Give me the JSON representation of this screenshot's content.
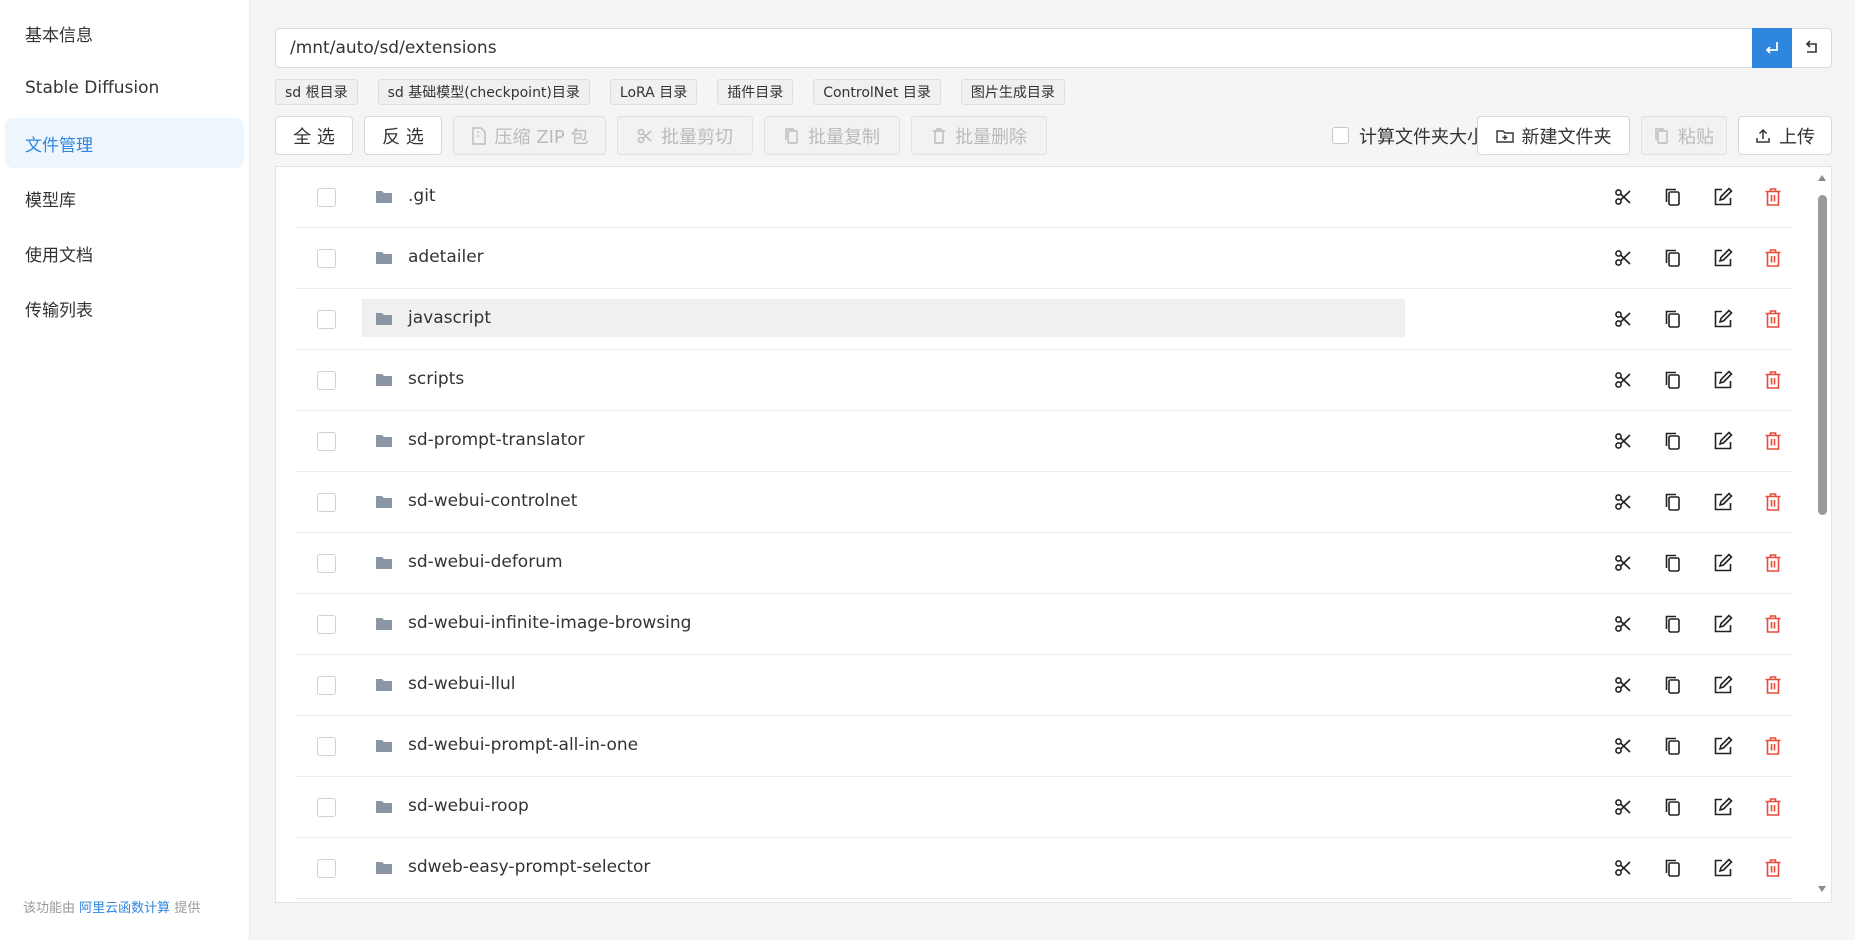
{
  "colors": {
    "accent": "#2e86de",
    "danger": "#e74c3c",
    "folder": "#8a96a3"
  },
  "sidebar": {
    "items": [
      {
        "label": "基本信息",
        "active": false
      },
      {
        "label": "Stable Diffusion",
        "active": false
      },
      {
        "label": "文件管理",
        "active": true
      },
      {
        "label": "模型库",
        "active": false
      },
      {
        "label": "使用文档",
        "active": false
      },
      {
        "label": "传输列表",
        "active": false
      }
    ],
    "footer": {
      "prefix": "该功能由",
      "link": "阿里云函数计算",
      "suffix": "提供"
    }
  },
  "path_bar": {
    "value": "/mnt/auto/sd/extensions",
    "go_icon": "enter-icon",
    "back_icon": "return-icon"
  },
  "shortcuts": [
    "sd 根目录",
    "sd 基础模型(checkpoint)目录",
    "LoRA 目录",
    "插件目录",
    "ControlNet 目录",
    "图片生成目录"
  ],
  "toolbar": {
    "select_all": "全 选",
    "invert": "反 选",
    "zip": "压缩 ZIP 包",
    "batch_cut": "批量剪切",
    "batch_copy": "批量复制",
    "batch_delete": "批量删除",
    "calc_size": "计算文件夹大小",
    "new_folder": "新建文件夹",
    "paste": "粘贴",
    "upload": "上传"
  },
  "files": [
    {
      "name": ".git",
      "highlighted": false
    },
    {
      "name": "adetailer",
      "highlighted": false
    },
    {
      "name": "javascript",
      "highlighted": true
    },
    {
      "name": "scripts",
      "highlighted": false
    },
    {
      "name": "sd-prompt-translator",
      "highlighted": false
    },
    {
      "name": "sd-webui-controlnet",
      "highlighted": false
    },
    {
      "name": "sd-webui-deforum",
      "highlighted": false
    },
    {
      "name": "sd-webui-infinite-image-browsing",
      "highlighted": false
    },
    {
      "name": "sd-webui-llul",
      "highlighted": false
    },
    {
      "name": "sd-webui-prompt-all-in-one",
      "highlighted": false
    },
    {
      "name": "sd-webui-roop",
      "highlighted": false
    },
    {
      "name": "sdweb-easy-prompt-selector",
      "highlighted": false
    }
  ]
}
